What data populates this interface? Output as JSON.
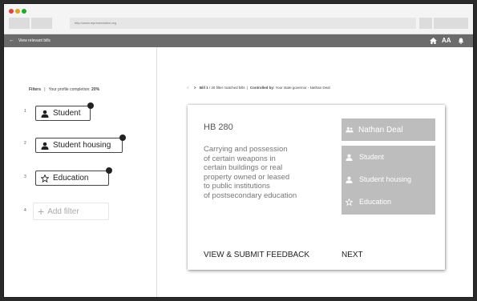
{
  "browser": {
    "url": "http://www.representation.org"
  },
  "appbar": {
    "back_label": "View relevant bills"
  },
  "sidebar": {
    "filters_label": "Filters",
    "separator": "|",
    "completion_label": "Your profile completion:",
    "completion_value": "20%",
    "filters": [
      {
        "number": "1",
        "label": "Student",
        "icon": "person-icon"
      },
      {
        "number": "2",
        "label": "Student housing",
        "icon": "person-icon"
      },
      {
        "number": "3",
        "label": "Education",
        "icon": "star-icon"
      }
    ],
    "add_filter": {
      "number": "4",
      "label": "Add filter"
    }
  },
  "breadcrumb": {
    "prev": "<",
    "next": ">",
    "bill_label": "Bill 1",
    "bill_count": "/ 30 filter matched bills",
    "separator": "|",
    "controlled_label": "Controlled by:",
    "controlled_value": "Your state governor - Nathan Deal"
  },
  "card": {
    "bill_number": "HB 280",
    "description_lines": [
      "Carrying and possession",
      "of certain weapons in",
      "certain buildings or real",
      "property owned or leased",
      "to public institutions",
      "of postsecondary education"
    ],
    "governor": "Nathan Deal",
    "tags": [
      {
        "label": "Student",
        "icon": "person-icon"
      },
      {
        "label": "Student housing",
        "icon": "person-icon"
      },
      {
        "label": "Education",
        "icon": "star-icon"
      }
    ],
    "feedback_label": "VIEW & SUBMIT FEEDBACK",
    "next_label": "NEXT"
  },
  "colors": {
    "appbar": "#6b6b6b",
    "tag_box": "#bdbdbd",
    "traffic_red": "#e0443e",
    "traffic_yellow": "#dea123",
    "traffic_green": "#1aab29"
  }
}
